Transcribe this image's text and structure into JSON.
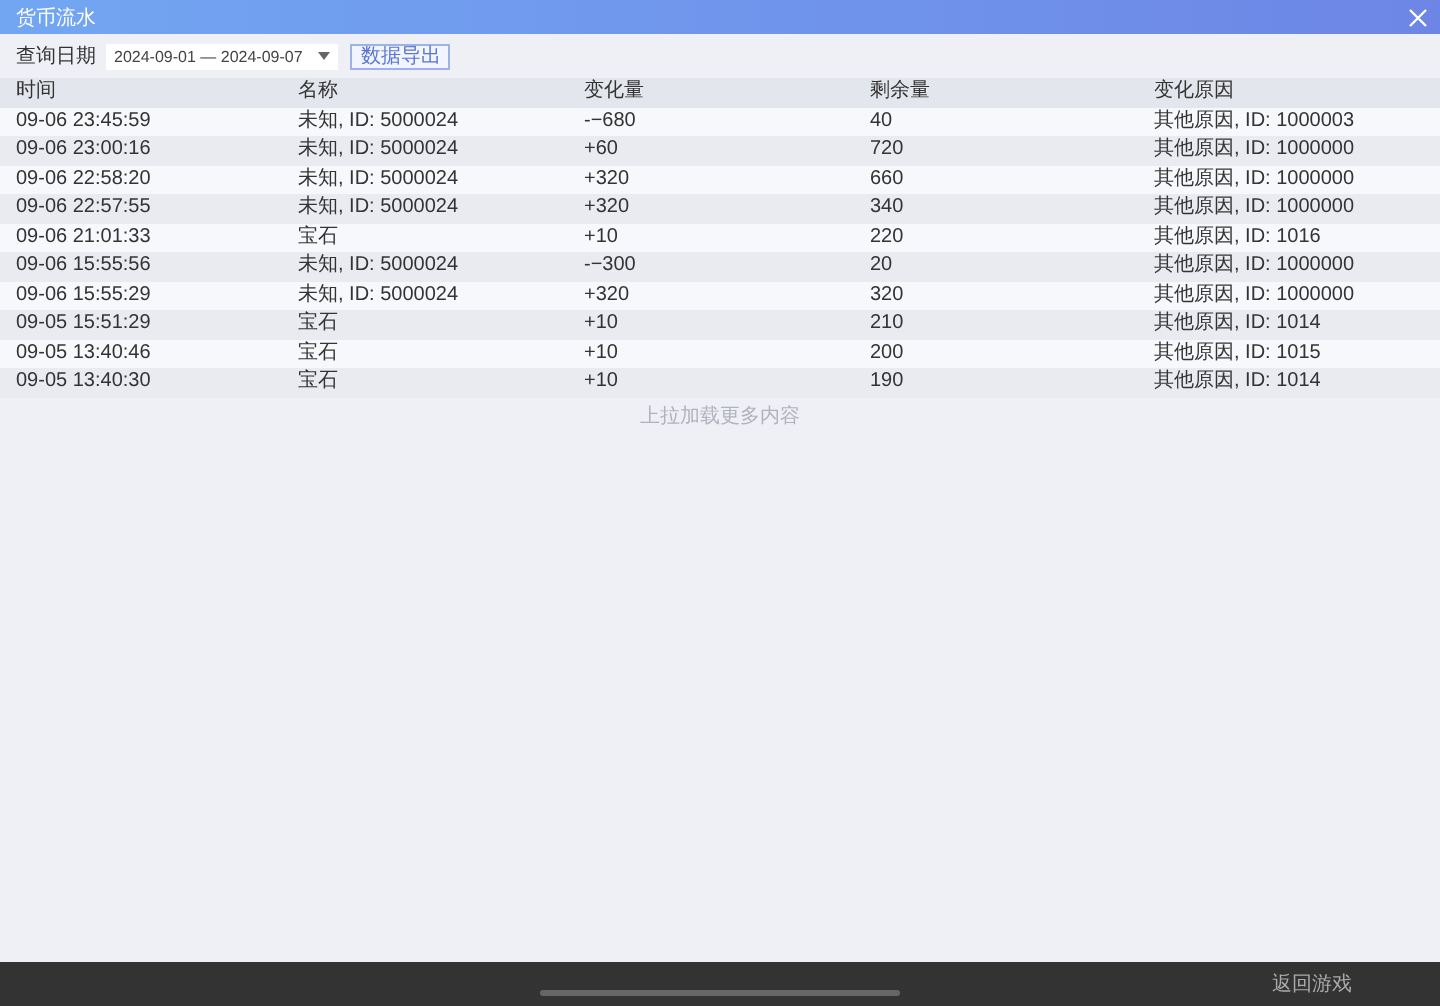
{
  "window": {
    "title": "货币流水"
  },
  "filter": {
    "label": "查询日期",
    "date_range": "2024-09-01 — 2024-09-07",
    "export_button": "数据导出"
  },
  "table": {
    "columns": [
      "时间",
      "名称",
      "变化量",
      "剩余量",
      "变化原因"
    ],
    "rows": [
      [
        "09-06 23:45:59",
        "未知, ID: 5000024",
        "-−680",
        "40",
        "其他原因, ID: 1000003"
      ],
      [
        "09-06 23:00:16",
        "未知, ID: 5000024",
        "+60",
        "720",
        "其他原因, ID: 1000000"
      ],
      [
        "09-06 22:58:20",
        "未知, ID: 5000024",
        "+320",
        "660",
        "其他原因, ID: 1000000"
      ],
      [
        "09-06 22:57:55",
        "未知, ID: 5000024",
        "+320",
        "340",
        "其他原因, ID: 1000000"
      ],
      [
        "09-06 21:01:33",
        "宝石",
        "+10",
        "220",
        "其他原因, ID: 1016"
      ],
      [
        "09-06 15:55:56",
        "未知, ID: 5000024",
        "-−300",
        "20",
        "其他原因, ID: 1000000"
      ],
      [
        "09-06 15:55:29",
        "未知, ID: 5000024",
        "+320",
        "320",
        "其他原因, ID: 1000000"
      ],
      [
        "09-05 15:51:29",
        "宝石",
        "+10",
        "210",
        "其他原因, ID: 1014"
      ],
      [
        "09-05 13:40:46",
        "宝石",
        "+10",
        "200",
        "其他原因, ID: 1015"
      ],
      [
        "09-05 13:40:30",
        "宝石",
        "+10",
        "190",
        "其他原因, ID: 1014"
      ]
    ]
  },
  "load_more_hint": "上拉加载更多内容",
  "bottom_bar": {
    "back_button": "返回游戏"
  }
}
